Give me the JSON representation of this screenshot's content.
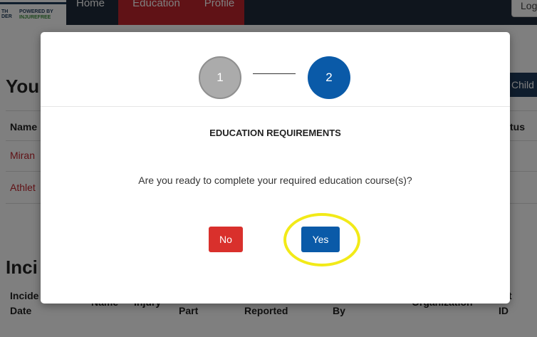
{
  "header": {
    "logo_line1": "TH\nDER",
    "logo_line2": "POWERED BY",
    "logo_line3": "INJUREFREE",
    "nav": [
      "Home",
      "Education",
      "Profile"
    ],
    "logout_label": "Log"
  },
  "page": {
    "section_heading": "You",
    "add_child_label": "Child",
    "table_headers": [
      "Name",
      "tus"
    ],
    "rows": [
      "Miran",
      "Athlet"
    ],
    "incidents_heading": "Inci",
    "incident_headers": [
      "Incide\nDate",
      "Name",
      "Injury",
      "Part",
      "Reported",
      "By",
      "Organization",
      "ort\nID"
    ]
  },
  "modal": {
    "steps": [
      "1",
      "2"
    ],
    "title": "EDUCATION REQUIREMENTS",
    "question": "Are you ready to complete your required education course(s)?",
    "no_label": "No",
    "yes_label": "Yes"
  },
  "colors": {
    "nav_bg": "#1e2a3a",
    "nav_active": "#c0242c",
    "primary": "#0a5aa8",
    "danger": "#d9302c",
    "step_inactive": "#ababab",
    "highlight": "#f2ea18"
  }
}
